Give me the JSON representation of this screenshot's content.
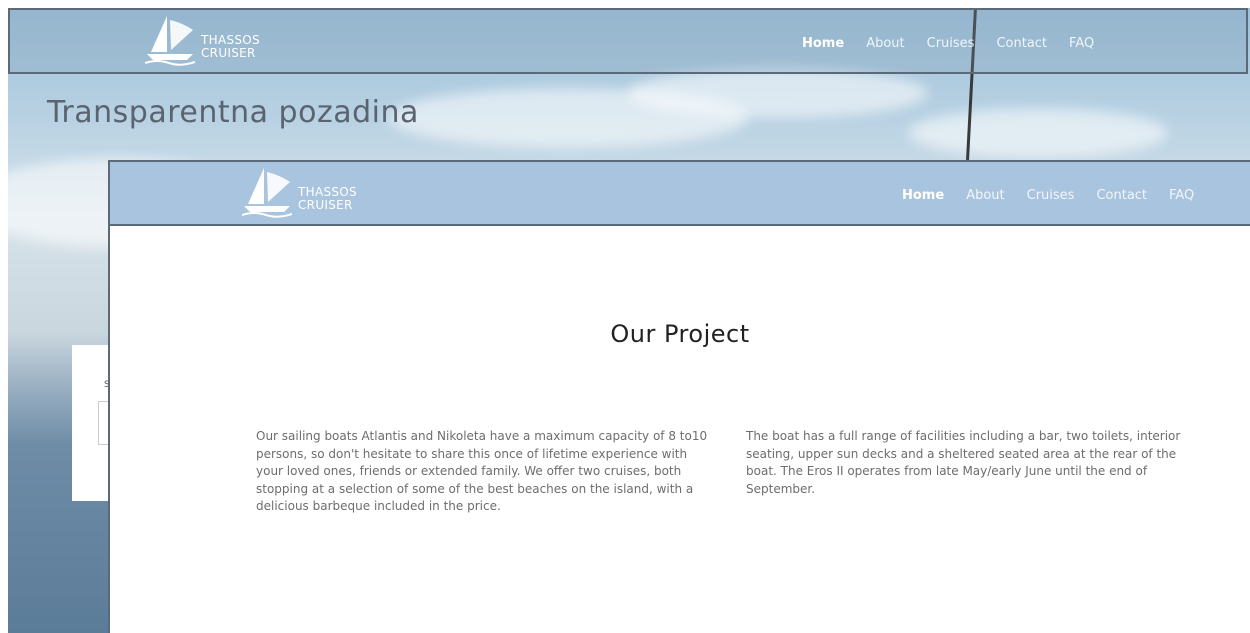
{
  "brand": {
    "line1": "THASSOS",
    "line2": "CRUISER"
  },
  "nav": {
    "items": [
      "Home",
      "About",
      "Cruises",
      "Contact",
      "FAQ"
    ],
    "active": "Home"
  },
  "section_heading": "Transparentna pozadina",
  "left_card": {
    "label": "SI"
  },
  "project": {
    "title": "Our Project",
    "col1": "Our sailing boats Atlantis and Nikoleta have a maximum capacity of 8 to10 persons, so don't hesitate to share this once of lifetime experience with your loved ones, friends or extended family. We offer two cruises, both stopping at a selection of some of the best beaches on the island, with a delicious barbeque included in the price.",
    "col2": "The boat has a full range of facilities including a bar, two toilets, interior seating, upper sun decks and a sheltered seated area at the rear of the boat. The Eros II operates from late May/early June until the end of September."
  },
  "colors": {
    "nav_solid": "#a9c4de",
    "nav_border": "#5a6a78",
    "body_text": "#6d6d6d",
    "heading_text": "#222222"
  }
}
